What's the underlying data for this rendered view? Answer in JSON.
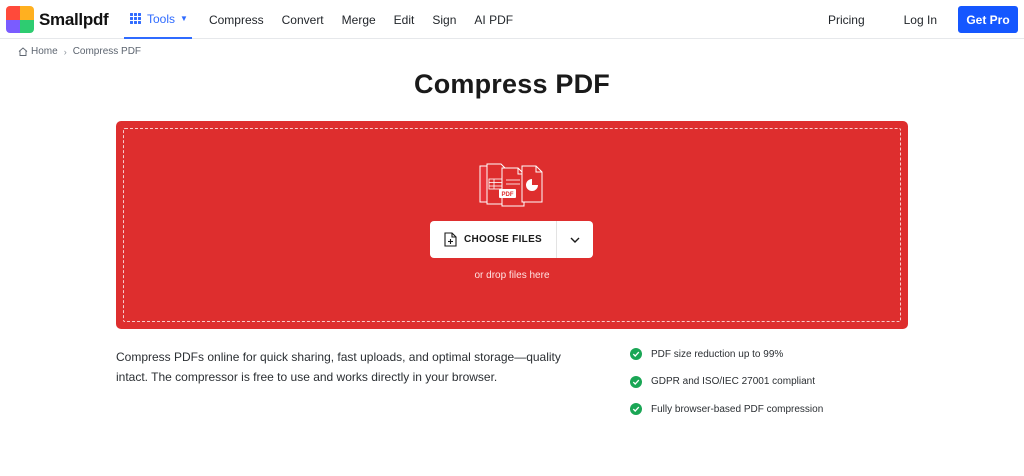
{
  "brand": {
    "name": "Smallpdf"
  },
  "nav": {
    "tools_label": "Tools",
    "items": [
      "Compress",
      "Convert",
      "Merge",
      "Edit",
      "Sign",
      "AI PDF"
    ],
    "pricing": "Pricing",
    "login": "Log In",
    "get_pro": "Get Pro"
  },
  "breadcrumb": {
    "home": "Home",
    "current": "Compress PDF"
  },
  "page": {
    "title": "Compress PDF"
  },
  "upload": {
    "choose_label": "CHOOSE FILES",
    "drop_hint": "or drop files here",
    "illustration_badge": "PDF"
  },
  "description": "Compress PDFs online for quick sharing, fast uploads, and optimal storage—quality intact. The compressor is free to use and works directly in your browser.",
  "features": [
    "PDF size reduction up to 99%",
    "GDPR and ISO/IEC 27001 compliant",
    "Fully browser-based PDF compression"
  ],
  "colors": {
    "accent_blue": "#1557ff",
    "dropzone_red": "#de2e2e",
    "check_green": "#1aa655"
  }
}
